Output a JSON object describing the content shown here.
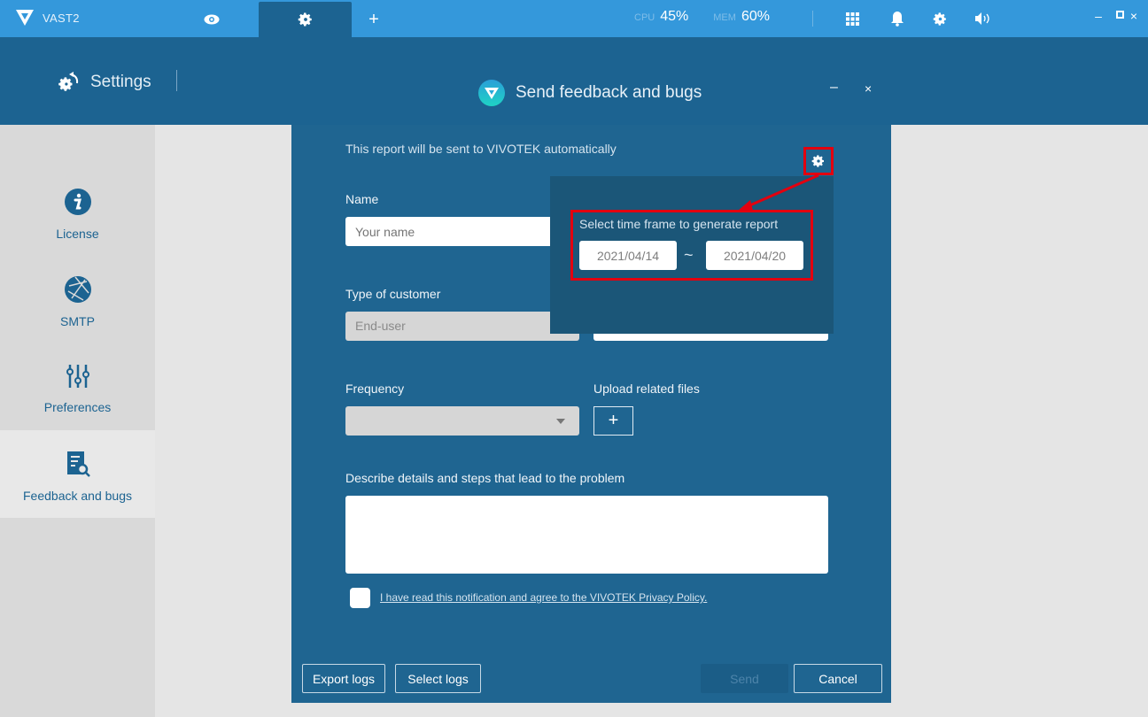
{
  "app": {
    "name": "VAST2",
    "tabs": [
      {
        "icon": "eye-icon",
        "label": "Live view"
      },
      {
        "icon": "gear-icon",
        "label": "Settings",
        "active": true
      },
      {
        "icon": "plus-icon",
        "label": "+"
      }
    ],
    "stats": {
      "cpu_label": "CPU",
      "cpu_value": "45%",
      "mem_label": "MEM",
      "mem_value": "60%"
    },
    "toolbar_icons": [
      "grid-icon",
      "bell-icon",
      "gear-icon",
      "speaker-icon"
    ],
    "window_controls": {
      "minimize": "–",
      "maximize": "◻",
      "close": "×"
    }
  },
  "header": {
    "title": "Settings"
  },
  "sidebar": {
    "items": [
      {
        "label": "License",
        "icon": "info-icon"
      },
      {
        "label": "SMTP",
        "icon": "globe-icon"
      },
      {
        "label": "Preferences",
        "icon": "sliders-icon"
      },
      {
        "label": "Feedback and bugs",
        "icon": "report-search-icon",
        "active": true
      }
    ]
  },
  "dialog": {
    "title": "Send feedback and bugs",
    "minimize": "–",
    "close": "×",
    "note": "This report will be sent to VIVOTEK automatically",
    "name_label": "Name",
    "name_placeholder": "Your name",
    "customer_label": "Type of customer",
    "customer_value": "End-user",
    "frequency_label": "Frequency",
    "frequency_value": "",
    "upload_label": "Upload related files",
    "upload_button": "+",
    "details_label": "Describe details and steps that lead to the problem",
    "details_value": "",
    "privacy_text": "I have read this notification and agree to the VIVOTEK Privacy Policy.",
    "privacy_checked": false,
    "buttons": {
      "export": "Export logs",
      "select": "Select logs",
      "send": "Send",
      "cancel": "Cancel"
    }
  },
  "popup": {
    "title": "Select time frame to generate report",
    "start_date": "2021/04/14",
    "separator": "~",
    "end_date": "2021/04/20",
    "annotation_color": "#e3000f"
  }
}
